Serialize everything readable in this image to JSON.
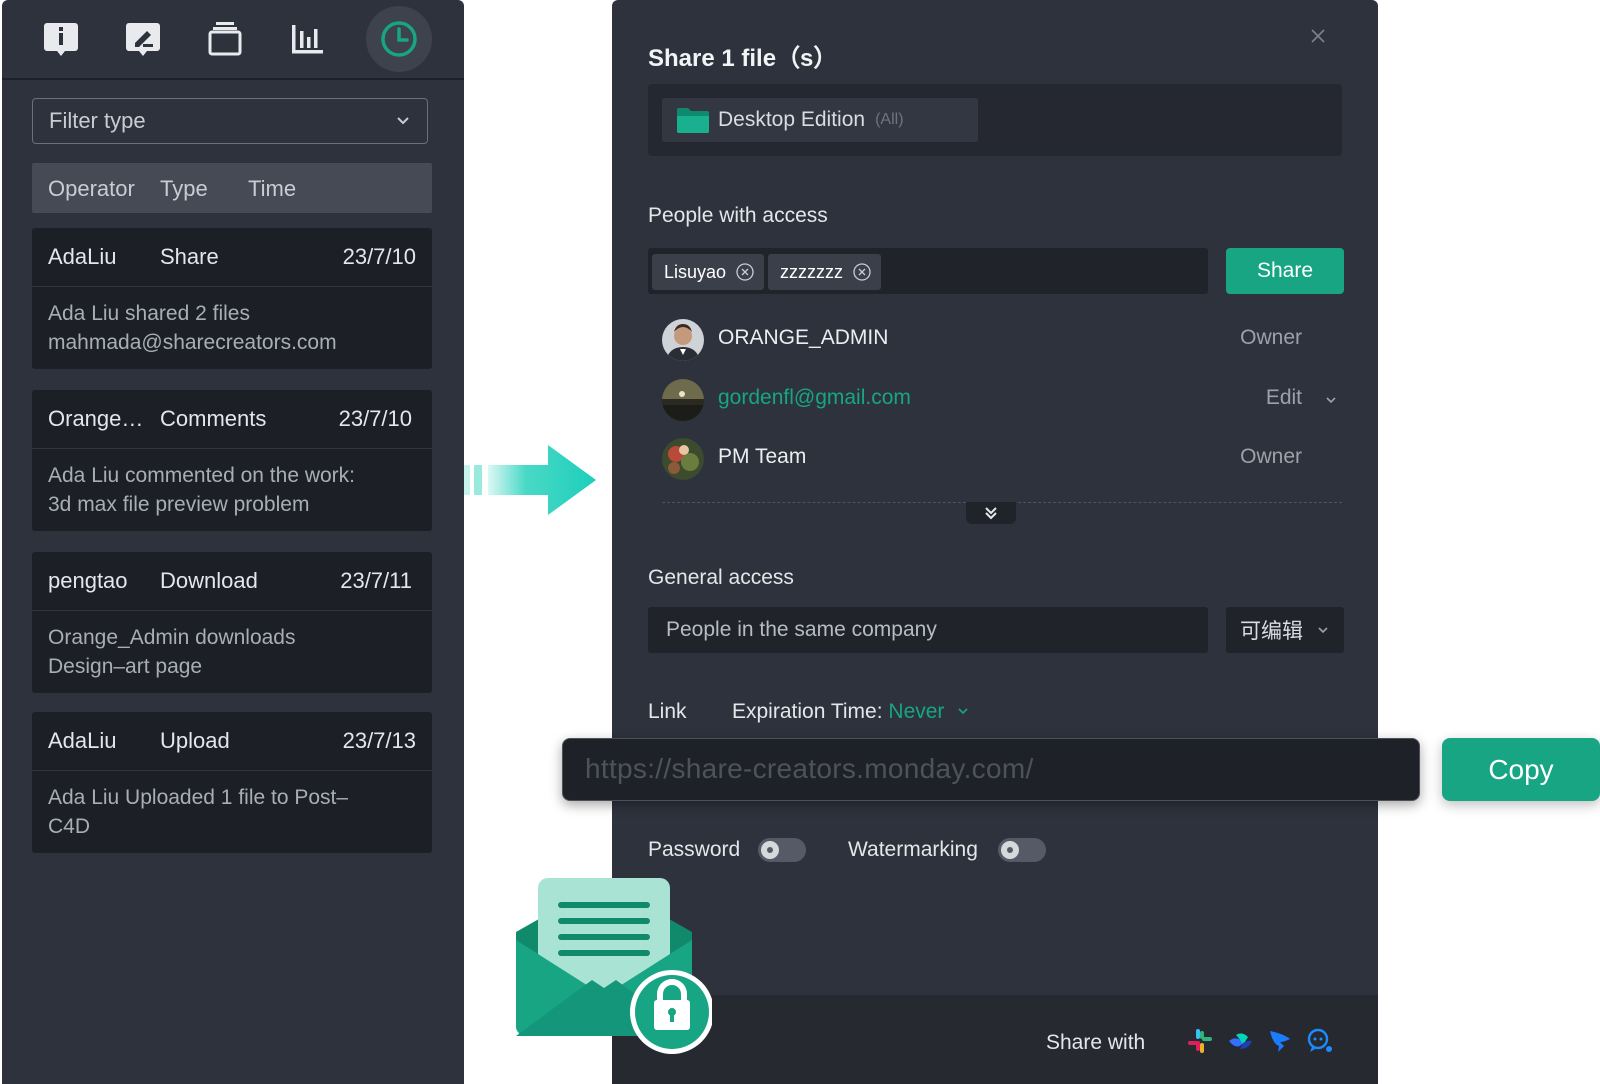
{
  "left_panel": {
    "toolbar": {
      "icons": [
        "info-icon",
        "edit-icon",
        "layers-icon",
        "chart-icon",
        "clock-icon"
      ],
      "active": "clock-icon"
    },
    "filter": {
      "value": "Filter type"
    },
    "list_header": {
      "operator": "Operator",
      "type": "Type",
      "time": "Time"
    },
    "activities": [
      {
        "operator": "AdaLiu",
        "type": "Share",
        "date": "23/7/10",
        "line1": "Ada Liu shared 2 files",
        "line2": "mahmada@sharecreators.com"
      },
      {
        "operator": "Orange…",
        "type": "Comments",
        "date": "23/7/10",
        "line1": "Ada Liu commented on the work:",
        "line2": "3d max file preview problem"
      },
      {
        "operator": "pengtao",
        "type": "Download",
        "date": "23/7/11",
        "line1": "Orange_Admin downloads",
        "line2": "Design–art page"
      },
      {
        "operator": "AdaLiu",
        "type": "Upload",
        "date": "23/7/13",
        "line1": "Ada Liu Uploaded 1 file to Post–",
        "line2": "C4D"
      }
    ]
  },
  "dialog": {
    "title": "Share 1 file（s）",
    "folder": {
      "name": "Desktop Edition",
      "scope": "(All)"
    },
    "people_label": "People with access",
    "tags": [
      "Lisuyao",
      "zzzzzzz"
    ],
    "share_button": "Share",
    "people": [
      {
        "name": "ORANGE_ADMIN",
        "role": "Owner"
      },
      {
        "name": "gordenfl@gmail.com",
        "role": "Edit"
      },
      {
        "name": "PM Team",
        "role": "Owner"
      }
    ],
    "general_label": "General access",
    "general_value": "People in the same company",
    "general_permission": "可编辑",
    "link_label": "Link",
    "expiration_label": "Expiration Time: ",
    "expiration_value": "Never",
    "password_label": "Password",
    "watermark_label": "Watermarking",
    "share_with_label": "Share with",
    "share_apps": [
      "slack-icon",
      "lark-icon",
      "dingtalk-icon",
      "wechat-work-icon"
    ]
  },
  "overlay": {
    "url": "https://share-creators.monday.com/",
    "copy_label": "Copy"
  },
  "colors": {
    "accent": "#17a584",
    "panel_bg": "#2e323c",
    "card_bg": "#1c1f26",
    "arrow": "#1ccfb9"
  }
}
